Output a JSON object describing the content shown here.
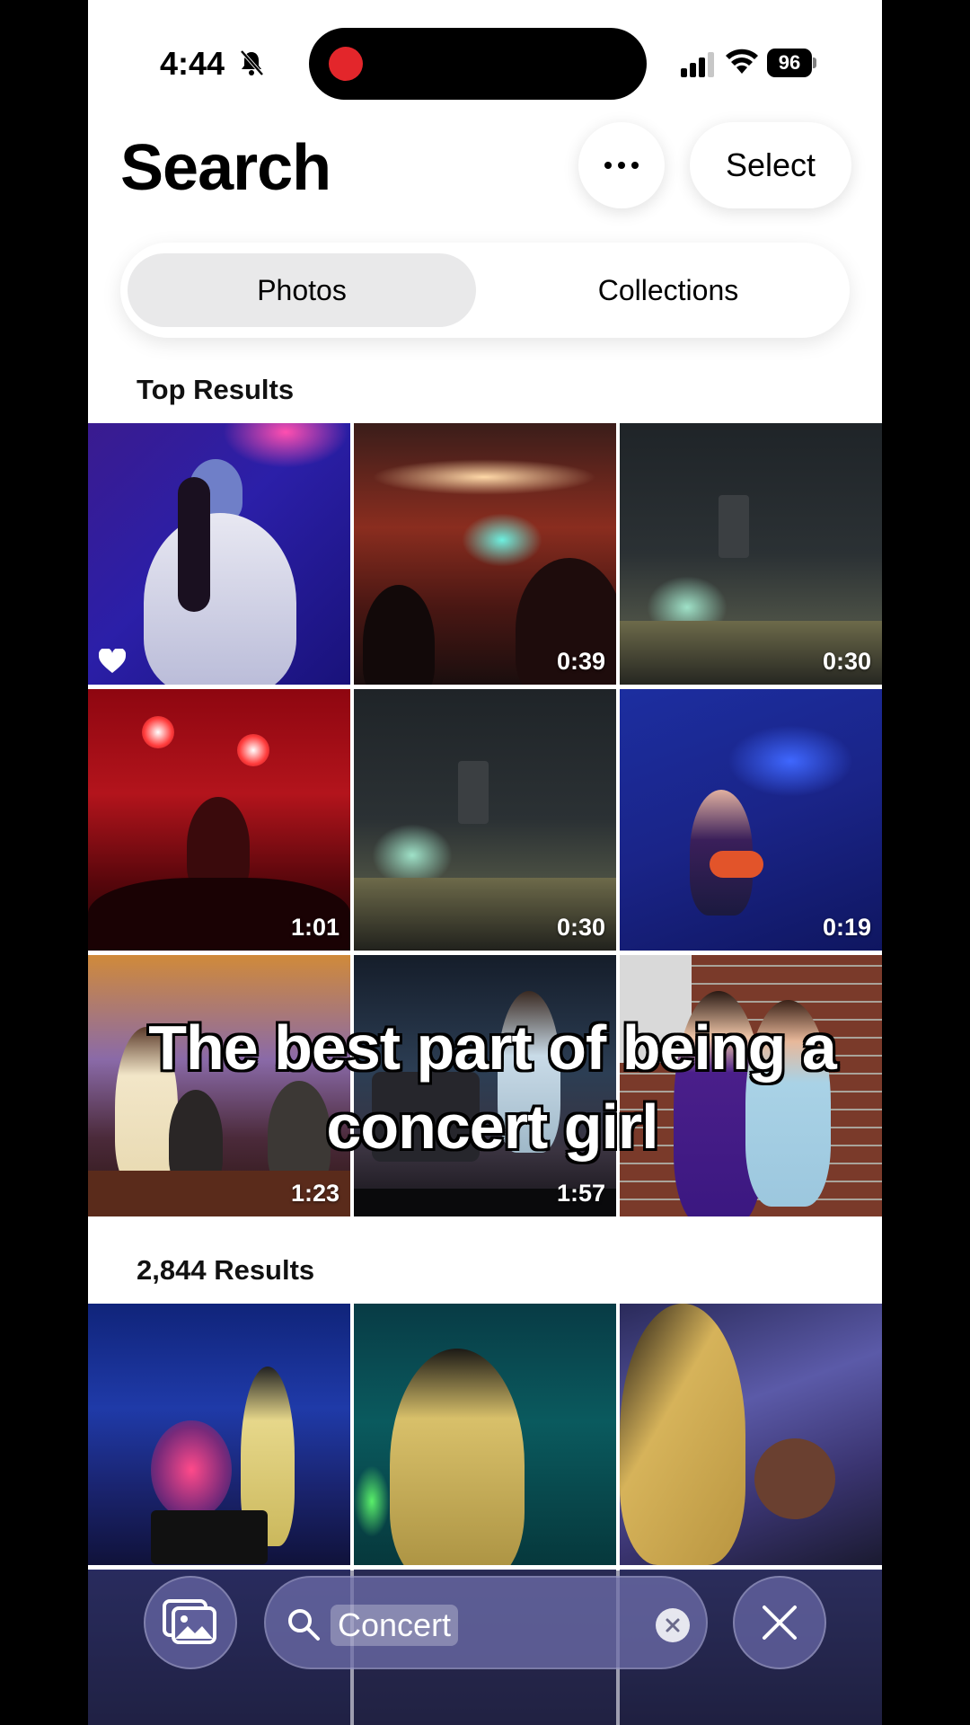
{
  "status_bar": {
    "time": "4:44",
    "battery": "96",
    "recording_color": "#e3262b"
  },
  "header": {
    "title": "Search",
    "more_icon": "ellipsis-icon",
    "select_label": "Select"
  },
  "segmented_control": {
    "tabs": [
      {
        "label": "Photos",
        "selected": true
      },
      {
        "label": "Collections",
        "selected": false
      }
    ]
  },
  "top_results": {
    "heading": "Top Results",
    "tiles": [
      {
        "subject": "singer-with-bandana",
        "duration": "",
        "favorite": true
      },
      {
        "subject": "arena-stage-crowd",
        "duration": "0:39",
        "favorite": false
      },
      {
        "subject": "stadium-night",
        "duration": "0:30",
        "favorite": false
      },
      {
        "subject": "guitarist-red-light",
        "duration": "1:01",
        "favorite": false
      },
      {
        "subject": "stadium-night-crowd",
        "duration": "0:30",
        "favorite": false
      },
      {
        "subject": "guitarist-blue-light",
        "duration": "0:19",
        "favorite": false
      },
      {
        "subject": "fringe-dress-stage",
        "duration": "1:23",
        "favorite": false
      },
      {
        "subject": "singer-guitar-stage",
        "duration": "1:57",
        "favorite": false
      },
      {
        "subject": "graduation-photo",
        "duration": "",
        "favorite": false
      }
    ]
  },
  "all_results": {
    "heading": "2,844 Results",
    "tiles": [
      {
        "subject": "singer-blue-screen"
      },
      {
        "subject": "singer-green-light"
      },
      {
        "subject": "singer-selfie-crowd"
      }
    ]
  },
  "caption": {
    "line1": "The best part of being a",
    "line2": "concert girl"
  },
  "bottom_bar": {
    "library_icon": "photo-library-icon",
    "search_query": "Concert",
    "clear_icon": "clear-icon",
    "close_icon": "close-icon"
  }
}
